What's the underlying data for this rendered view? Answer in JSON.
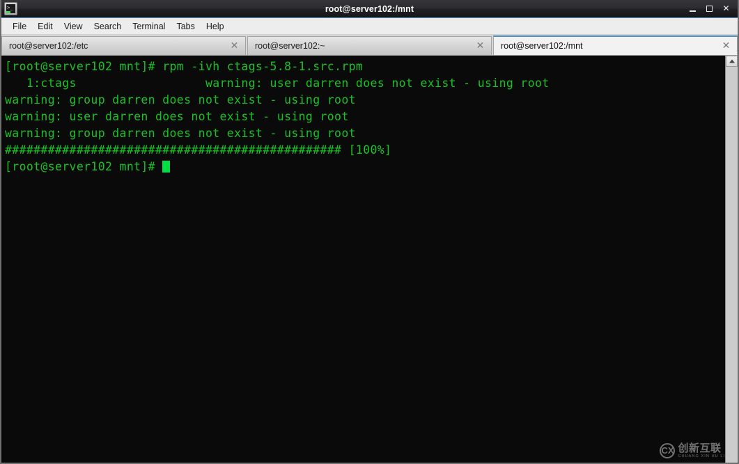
{
  "window": {
    "title": "root@server102:/mnt",
    "icon": "terminal-icon",
    "controls": {
      "minimize": "_",
      "maximize": "□",
      "close": "✕"
    }
  },
  "menubar": {
    "items": [
      {
        "label": "File"
      },
      {
        "label": "Edit"
      },
      {
        "label": "View"
      },
      {
        "label": "Search"
      },
      {
        "label": "Terminal"
      },
      {
        "label": "Tabs"
      },
      {
        "label": "Help"
      }
    ]
  },
  "tabs": {
    "close_glyph": "✕",
    "items": [
      {
        "label": "root@server102:/etc",
        "active": false
      },
      {
        "label": "root@server102:~",
        "active": false
      },
      {
        "label": "root@server102:/mnt",
        "active": true
      }
    ]
  },
  "terminal": {
    "colors": {
      "background": "#0a0a0a",
      "foreground": "#16c322",
      "cursor": "#00dd44"
    },
    "lines": [
      "[root@server102 mnt]# rpm -ivh ctags-5.8-1.src.rpm",
      "   1:ctags                  warning: user darren does not exist - using root",
      "warning: group darren does not exist - using root",
      "warning: user darren does not exist - using root",
      "warning: group darren does not exist - using root",
      "############################################### [100%]"
    ],
    "prompt": "[root@server102 mnt]# "
  },
  "scrollbar": {
    "up_arrow": "scroll-up-arrow"
  },
  "watermark": {
    "logo": "CX",
    "chinese": "创新互联",
    "pinyin": "CHUANG XIN HU LIAN"
  }
}
